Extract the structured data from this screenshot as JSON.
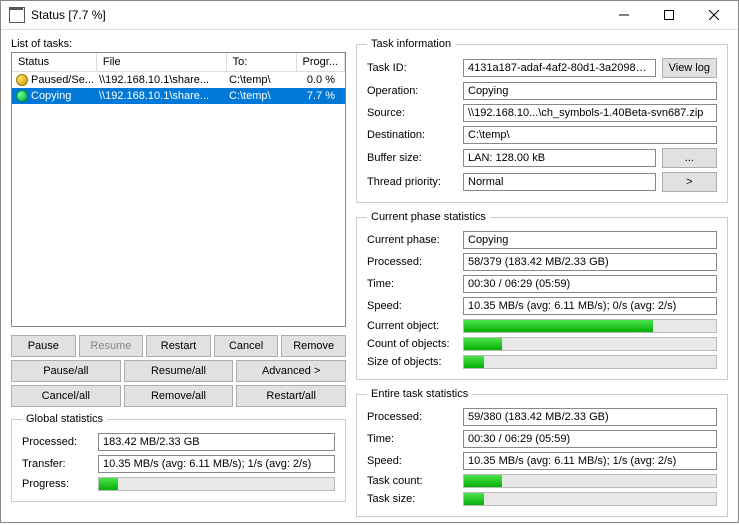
{
  "window": {
    "title": "Status [7.7 %]"
  },
  "taskList": {
    "label": "List of tasks:",
    "headers": {
      "status": "Status",
      "file": "File",
      "to": "To:",
      "prog": "Progr..."
    },
    "rows": [
      {
        "status": "Paused/Se...",
        "file": "\\\\192.168.10.1\\share...",
        "to": "C:\\temp\\",
        "prog": "0.0 %"
      },
      {
        "status": "Copying",
        "file": "\\\\192.168.10.1\\share...",
        "to": "C:\\temp\\",
        "prog": "7.7 %"
      }
    ]
  },
  "buttons": {
    "pause": "Pause",
    "resume": "Resume",
    "restart": "Restart",
    "cancel": "Cancel",
    "remove": "Remove",
    "pauseAll": "Pause/all",
    "resumeAll": "Resume/all",
    "advanced": "Advanced >",
    "cancelAll": "Cancel/all",
    "removeAll": "Remove/all",
    "restartAll": "Restart/all"
  },
  "globalStats": {
    "legend": "Global statistics",
    "processedLabel": "Processed:",
    "processed": "183.42 MB/2.33 GB",
    "transferLabel": "Transfer:",
    "transfer": "10.35 MB/s (avg: 6.11 MB/s); 1/s (avg: 2/s)",
    "progressLabel": "Progress:",
    "progressPct": 8
  },
  "taskInfo": {
    "legend": "Task information",
    "taskIdLabel": "Task ID:",
    "taskId": "4131a187-adaf-4af2-80d1-3a2098a...",
    "viewLog": "View log",
    "operationLabel": "Operation:",
    "operation": "Copying",
    "sourceLabel": "Source:",
    "source": "\\\\192.168.10...\\ch_symbols-1.40Beta-svn687.zip",
    "destLabel": "Destination:",
    "dest": "C:\\temp\\",
    "bufferLabel": "Buffer size:",
    "buffer": "LAN: 128.00 kB",
    "bufferBtn": "...",
    "priorityLabel": "Thread priority:",
    "priority": "Normal",
    "priorityBtn": ">"
  },
  "phaseStats": {
    "legend": "Current phase statistics",
    "phaseLabel": "Current phase:",
    "phase": "Copying",
    "processedLabel": "Processed:",
    "processed": "58/379 (183.42 MB/2.33 GB)",
    "timeLabel": "Time:",
    "time": "00:30 / 06:29 (05:59)",
    "speedLabel": "Speed:",
    "speed": "10.35 MB/s (avg: 6.11 MB/s); 0/s (avg: 2/s)",
    "currentObjLabel": "Current object:",
    "currentObjPct": 75,
    "countObjLabel": "Count of objects:",
    "countObjPct": 15,
    "sizeObjLabel": "Size of objects:",
    "sizeObjPct": 8
  },
  "entireStats": {
    "legend": "Entire task statistics",
    "processedLabel": "Processed:",
    "processed": "59/380 (183.42 MB/2.33 GB)",
    "timeLabel": "Time:",
    "time": "00:30 / 06:29 (05:59)",
    "speedLabel": "Speed:",
    "speed": "10.35 MB/s (avg: 6.11 MB/s); 1/s (avg: 2/s)",
    "taskCountLabel": "Task count:",
    "taskCountPct": 15,
    "taskSizeLabel": "Task size:",
    "taskSizePct": 8
  }
}
